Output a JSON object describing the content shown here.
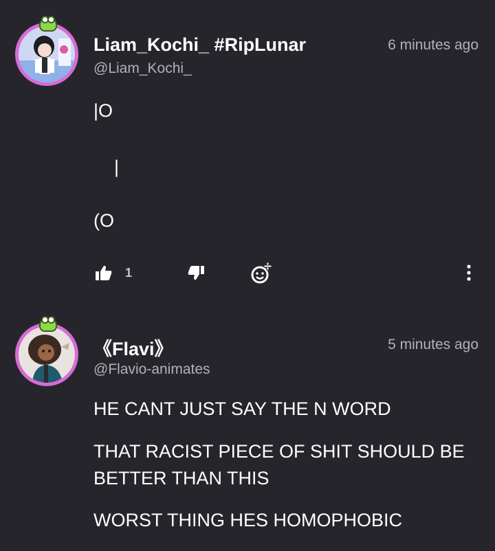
{
  "comments": [
    {
      "name": "Liam_Kochi_ #RipLunar",
      "handle": "@Liam_Kochi_",
      "time": "6 minutes ago",
      "lines": [
        "|O",
        "|",
        "(O"
      ],
      "like_count": "1",
      "avatar_icon": "anime-character-avatar",
      "badge_icon": "frog-badge-icon"
    },
    {
      "name": "《Flavi》",
      "handle": "@Flavio-animates",
      "time": "5 minutes ago",
      "lines": [
        "HE CANT JUST SAY THE N WORD",
        "THAT RACIST PIECE OF SHIT SHOULD BE",
        "BETTER THAN THIS",
        "WORST THING HES HOMOPHOBIC"
      ],
      "avatar_icon": "drawn-character-avatar",
      "badge_icon": "frog-badge-icon"
    }
  ],
  "colors": {
    "background": "#27252c",
    "avatar_ring": "#d86bd6",
    "secondary_text": "#b3b1b6",
    "primary_text": "#ffffff"
  },
  "action_icons": [
    "thumbs-up-icon",
    "thumbs-down-icon",
    "add-reaction-icon",
    "more-options-icon"
  ]
}
